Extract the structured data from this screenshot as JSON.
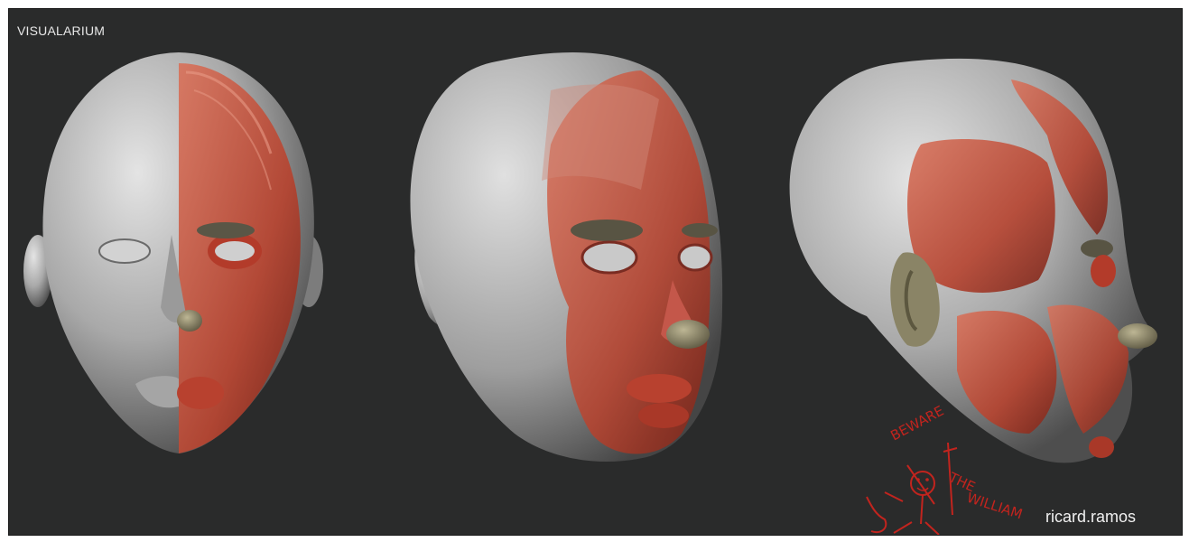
{
  "brand": {
    "text": "VISUALARIUM"
  },
  "credit": {
    "text": "ricard.ramos"
  },
  "doodle": {
    "word_1": "BEWARE",
    "word_2": "THE",
    "word_3": "WILLIAM"
  },
  "colors": {
    "background": "#2a2b2b",
    "frame": "#ffffff",
    "skin": "#bdbdbd",
    "muscle": "#c7533f",
    "cartilage": "#8a8466",
    "doodle_ink": "#c2241e"
  },
  "views": [
    {
      "view": "front-half-anatomy"
    },
    {
      "view": "three-quarter"
    },
    {
      "view": "side-profile"
    }
  ]
}
